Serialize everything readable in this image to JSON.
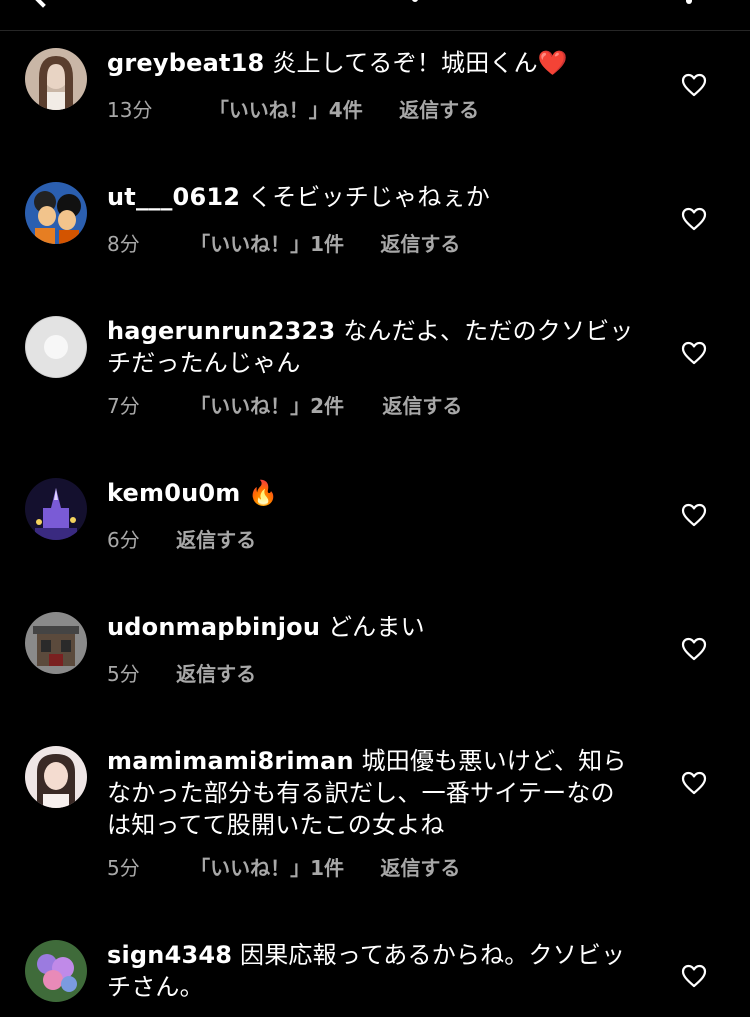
{
  "comments": [
    {
      "username": "greybeat18",
      "text": "炎上してるぞ！城田くん❤️",
      "time": "13分",
      "likes": "「いいね！」4件",
      "reply": "返信する"
    },
    {
      "username": "ut___0612",
      "text": "くそビッチじゃねぇか",
      "time": "8分",
      "likes": "「いいね！」1件",
      "reply": "返信する"
    },
    {
      "username": "hagerunrun2323",
      "text": "なんだよ、ただのクソビッチだったんじゃん",
      "time": "7分",
      "likes": "「いいね！」2件",
      "reply": "返信する"
    },
    {
      "username": "kem0u0m",
      "text": "🔥",
      "time": "6分",
      "likes": "",
      "reply": "返信する"
    },
    {
      "username": "udonmapbinjou",
      "text": "どんまい",
      "time": "5分",
      "likes": "",
      "reply": "返信する"
    },
    {
      "username": "mamimami8riman",
      "text": "城田優も悪いけど、知らなかった部分も有る訳だし、一番サイテーなのは知ってて股開いたこの女よね",
      "time": "5分",
      "likes": "「いいね！」1件",
      "reply": "返信する"
    },
    {
      "username": "sign4348",
      "text": "因果応報ってあるからね。クソビッチさん。",
      "time": "",
      "likes": "",
      "reply": ""
    }
  ]
}
